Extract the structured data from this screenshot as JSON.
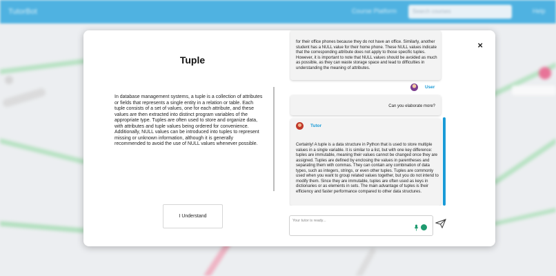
{
  "background": {
    "brand": "TutorBot",
    "nav_link": "Course Platform",
    "search_placeholder": "Search courses",
    "user_label": "Help"
  },
  "modal": {
    "title": "Tuple",
    "description": "In database management systems, a tuple is a collection of attributes or fields that represents a single entity in a relation or table. Each tuple consists of a set of values, one for each attribute, and these values are then extracted into distinct program variables of the appropriate type. Tuples are often used to store and organize data, with attributes and tuple values being ordered for convenience. Additionally, NULL values can be introduced into tuples to represent missing or unknown information, although it is generally recommended to avoid the use of NULL values whenever possible.",
    "understand_button": "I Understand",
    "close_label": "×"
  },
  "chat": {
    "messages": [
      {
        "role": "Tutor",
        "text": "for their office phones because they do not have an office. Similarly, another student has a NULL value for their home phone. These NULL values indicate that the corresponding attribute does not apply to those specific tuples. However, it is important to note that NULL values should be avoided as much as possible, as they can waste storage space and lead to difficulties in understanding the meaning of attributes."
      },
      {
        "role": "User",
        "text": "Can you elaborate more?"
      },
      {
        "role": "Tutor",
        "text": "Certainly! A tuple is a data structure in Python that is used to store multiple values in a single variable. It is similar to a list, but with one key difference: tuples are immutable, meaning their values cannot be changed once they are assigned. Tuples are defined by enclosing the values in parentheses and separating them with commas. They can contain any combination of data types, such as integers, strings, or even other tuples. Tuples are commonly used when you want to group related values together, but you do not intend to modify them. Since they are immutable, tuples are often used as keys in dictionaries or as elements in sets. The main advantage of tuples is their efficiency and faster performance compared to other data structures."
      }
    ],
    "input_placeholder": "Your tutor is ready...",
    "colors": {
      "accent": "#1a9bd7",
      "tool": "#1e9a6f"
    }
  }
}
